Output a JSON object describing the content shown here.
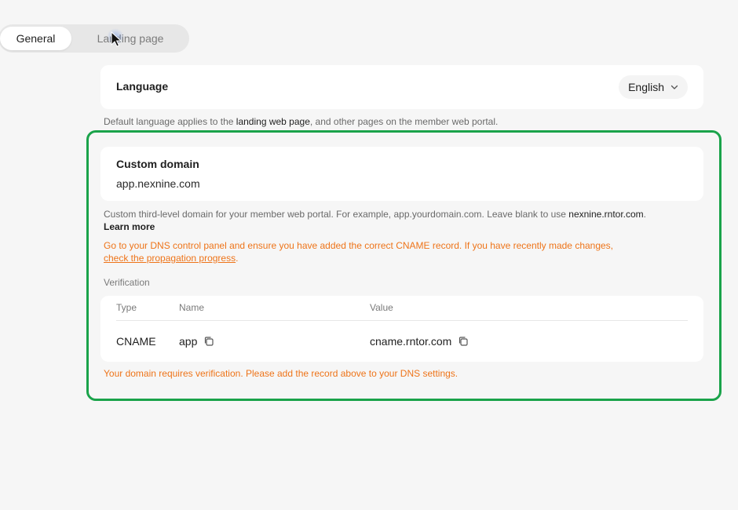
{
  "tabs": [
    {
      "label": "General",
      "active": true
    },
    {
      "label": "Landing page",
      "active": false
    }
  ],
  "language": {
    "title": "Language",
    "selected": "English",
    "help_prefix": "Default language applies to the ",
    "help_strong": "landing web page",
    "help_suffix": ", and other pages on the member web portal."
  },
  "custom_domain": {
    "title": "Custom domain",
    "value": "app.nexnine.com",
    "help_text": "Custom third-level domain for your member web portal. For example, app.yourdomain.com. Leave blank to use ",
    "help_strong": "nexnine.rntor.com",
    "help_end": ".",
    "learn_more": "Learn more",
    "warning_text": "Go to your DNS control panel and ensure you have added the correct CNAME record. If you have recently made changes,",
    "warning_link": "check the propagation progress",
    "warning_end": "."
  },
  "verification": {
    "label": "Verification",
    "headers": {
      "type": "Type",
      "name": "Name",
      "value": "Value"
    },
    "row": {
      "type": "CNAME",
      "name": "app",
      "value": "cname.rntor.com"
    },
    "message": "Your domain requires verification. Please add the record above to your DNS settings."
  },
  "colors": {
    "highlight_border": "#1aa34a",
    "warning": "#ee7419"
  },
  "icons": {
    "copy": "copy-icon",
    "chevron": "chevron-down-icon",
    "cursor": "mouse-cursor"
  }
}
